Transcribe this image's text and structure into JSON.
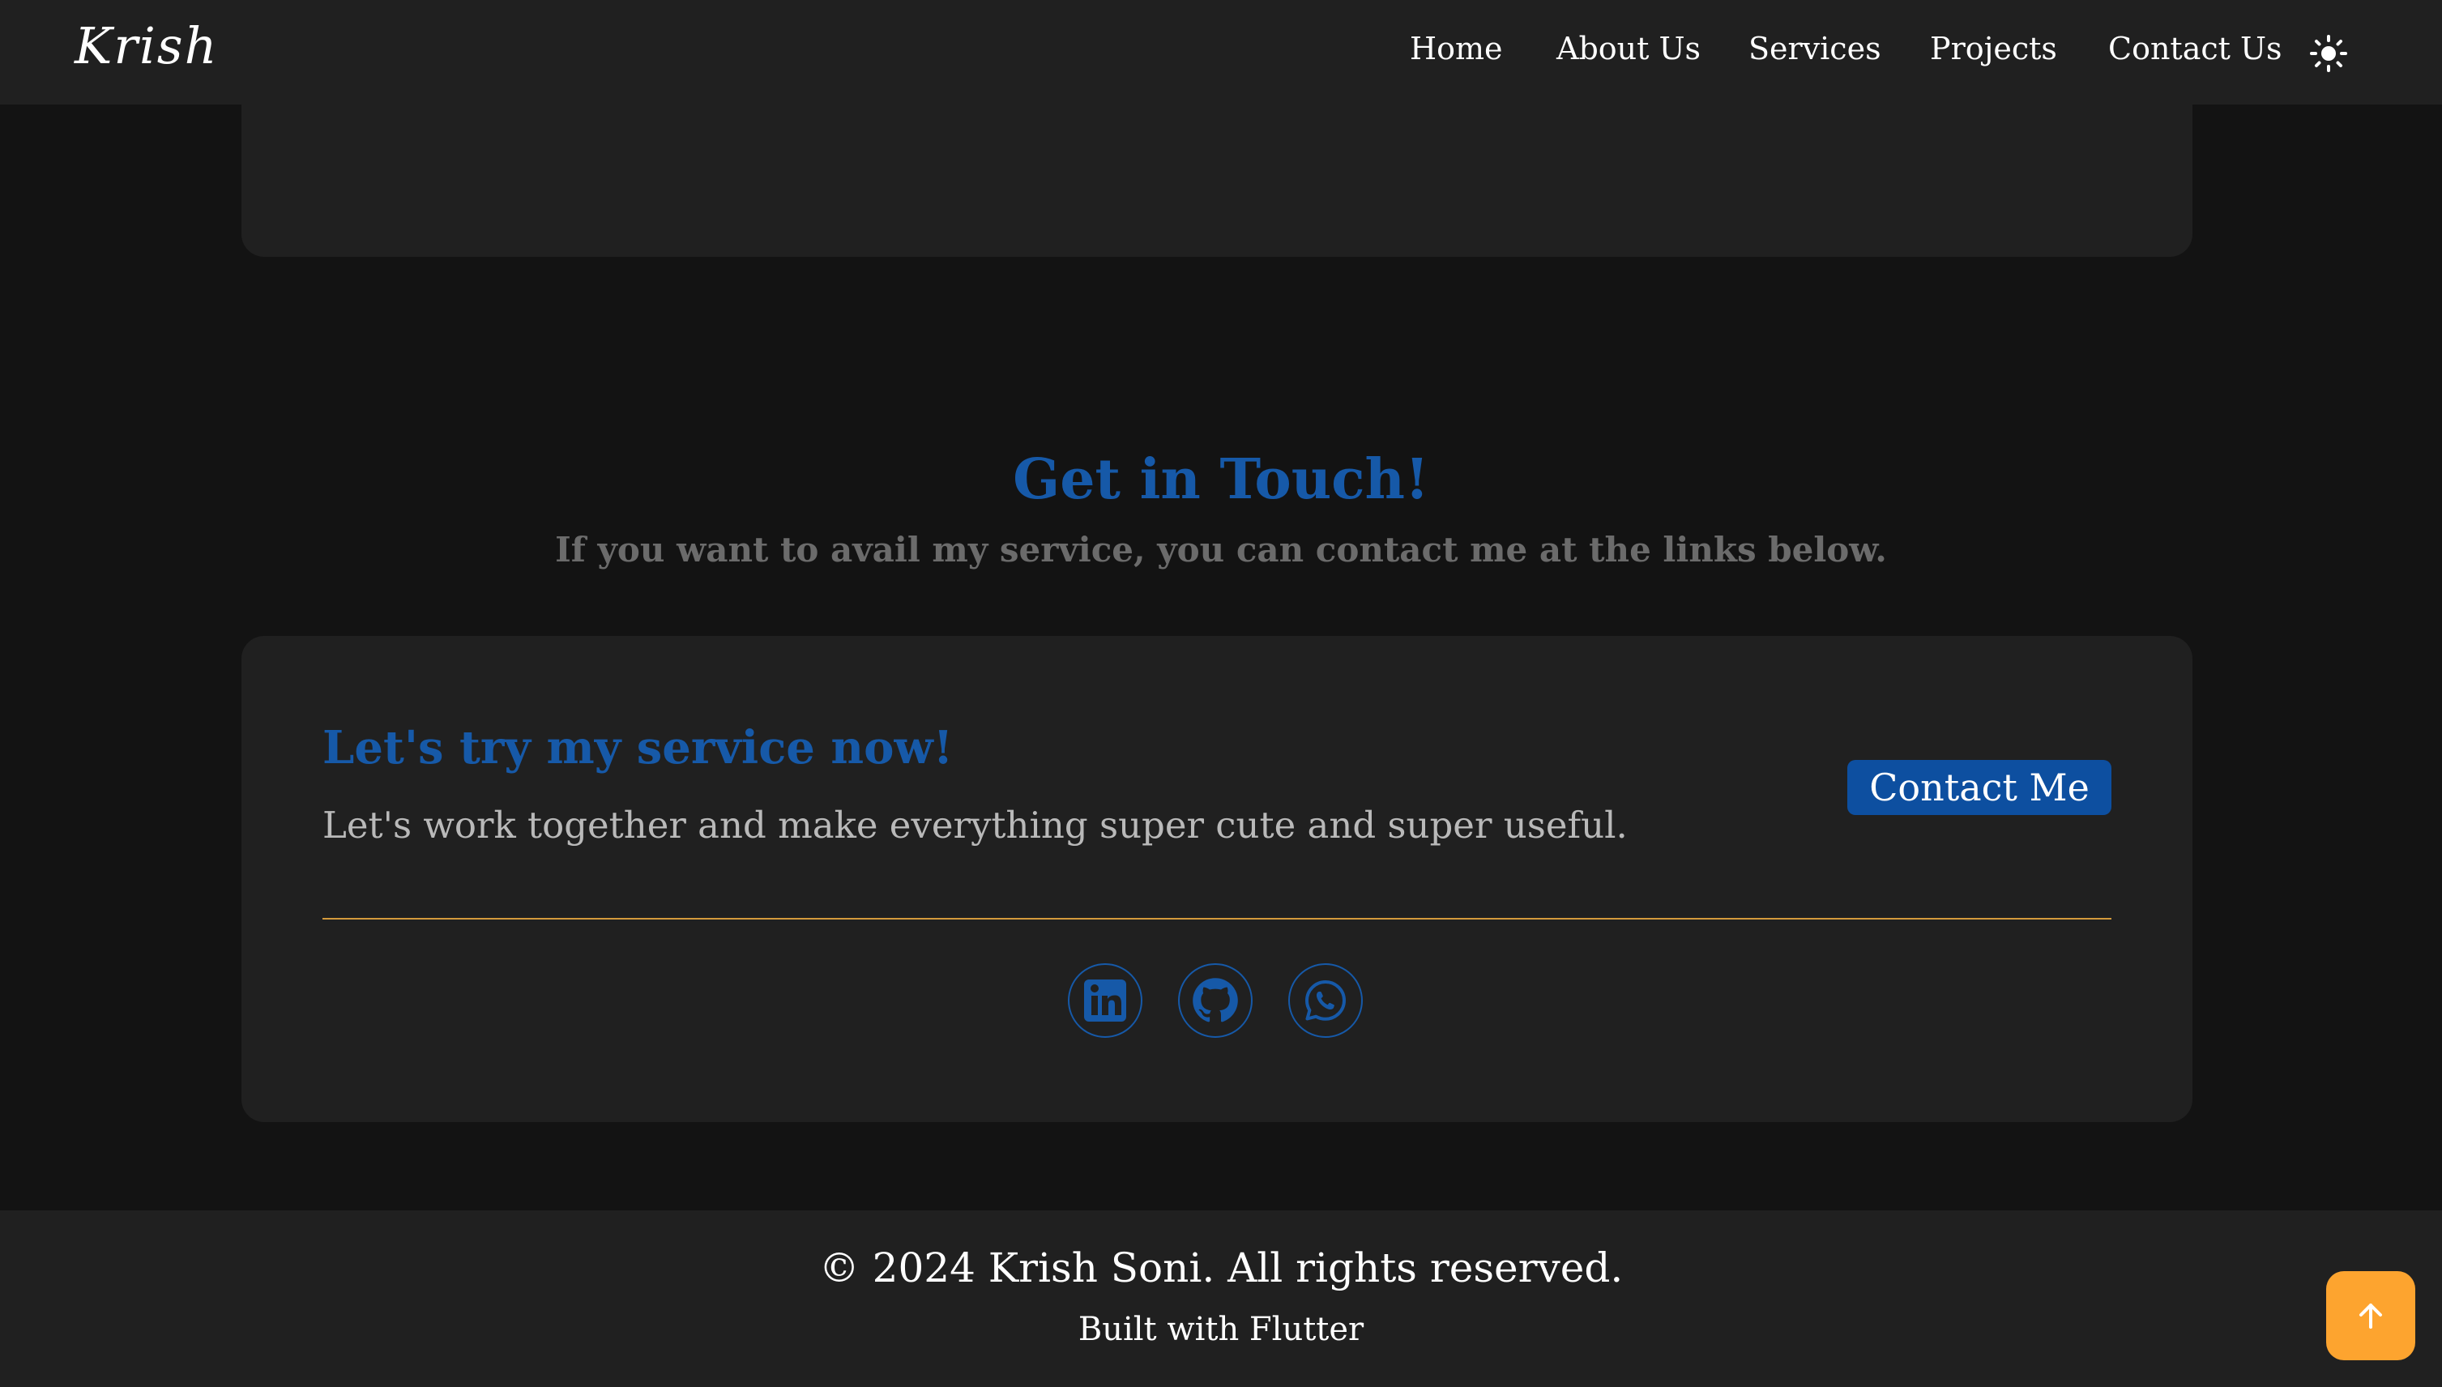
{
  "header": {
    "logo": "Krish",
    "nav": [
      {
        "label": "Home"
      },
      {
        "label": "About Us"
      },
      {
        "label": "Services"
      },
      {
        "label": "Projects"
      },
      {
        "label": "Contact Us"
      }
    ],
    "theme_toggle_icon": "sun-icon"
  },
  "contact_section": {
    "title": "Get in Touch!",
    "subtitle": "If you want to avail my service, you can contact me at the links below.",
    "card": {
      "title": "Let's try my service now!",
      "text": "Let's work together and make everything super cute and super useful.",
      "button_label": "Contact Me",
      "socials": [
        {
          "icon": "linkedin-icon"
        },
        {
          "icon": "github-icon"
        },
        {
          "icon": "whatsapp-icon"
        }
      ]
    }
  },
  "footer": {
    "copyright": "© 2024 Krish Soni. All rights reserved.",
    "built_with": "Built with Flutter"
  },
  "scroll_top": {
    "icon": "arrow-up-icon"
  },
  "colors": {
    "background": "#131313",
    "surface": "#202020",
    "accent_blue": "#1659a8",
    "button_blue": "#0d4fa0",
    "divider_gold": "#d39a3c",
    "scroll_button": "#fda42f"
  }
}
